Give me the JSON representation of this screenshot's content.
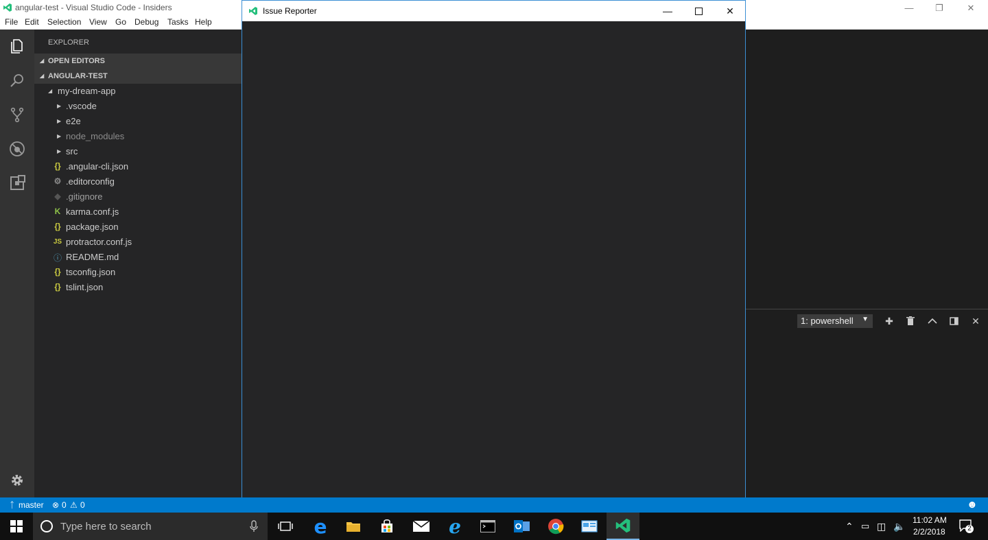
{
  "window": {
    "title": "angular-test - Visual Studio Code - Insiders"
  },
  "menu": [
    "File",
    "Edit",
    "Selection",
    "View",
    "Go",
    "Debug",
    "Tasks",
    "Help"
  ],
  "activity_bar": {
    "items": [
      "explorer-icon",
      "search-icon",
      "source-control-icon",
      "debug-icon",
      "extensions-icon"
    ],
    "bottom": "gear-icon"
  },
  "sidebar": {
    "header": "EXPLORER",
    "open_editors": "OPEN EDITORS",
    "workspace": "ANGULAR-TEST",
    "tree": [
      {
        "label": "my-dream-app",
        "type": "folder-open"
      },
      {
        "label": ".vscode",
        "type": "folder"
      },
      {
        "label": "e2e",
        "type": "folder"
      },
      {
        "label": "node_modules",
        "type": "folder",
        "dim": true
      },
      {
        "label": "src",
        "type": "folder"
      },
      {
        "label": ".angular-cli.json",
        "type": "json"
      },
      {
        "label": ".editorconfig",
        "type": "config"
      },
      {
        "label": ".gitignore",
        "type": "git",
        "dim": true
      },
      {
        "label": "karma.conf.js",
        "type": "karma"
      },
      {
        "label": "package.json",
        "type": "json"
      },
      {
        "label": "protractor.conf.js",
        "type": "js"
      },
      {
        "label": "README.md",
        "type": "info"
      },
      {
        "label": "tsconfig.json",
        "type": "json"
      },
      {
        "label": "tslint.json",
        "type": "json"
      }
    ]
  },
  "panel": {
    "terminal_select": "1: powershell"
  },
  "issue_reporter": {
    "title": "Issue Reporter"
  },
  "statusbar": {
    "branch": "master",
    "errors": "0",
    "warnings": "0"
  },
  "taskbar": {
    "search_placeholder": "Type here to search",
    "time": "11:02 AM",
    "date": "2/2/2018",
    "notifications": "2"
  },
  "colors": {
    "statusbar": "#007acc",
    "sidebar": "#252526",
    "activity": "#333333",
    "editor": "#1e1e1e",
    "json_icon": "#cbcb41",
    "karma_icon": "#8dc149",
    "info_icon": "#519aba"
  }
}
